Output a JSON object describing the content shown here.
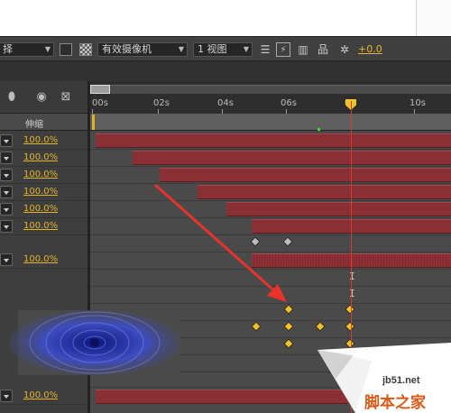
{
  "viewer_toolbar": {
    "partial_label": "择",
    "camera_dropdown": "有效摄像机",
    "view_dropdown": "1 视图",
    "exposure_value": "+0.0"
  },
  "ruler": {
    "ticks": [
      "00s",
      "02s",
      "04s",
      "06s",
      "08s",
      "10s"
    ],
    "current_time_label": "0"
  },
  "layers_header": {
    "stretch_label": "伸缩"
  },
  "layers": [
    {
      "stretch": "100.0%"
    },
    {
      "stretch": "100.0%"
    },
    {
      "stretch": "100.0%"
    },
    {
      "stretch": "100.0%"
    },
    {
      "stretch": "100.0%"
    },
    {
      "stretch": "100.0%"
    },
    {
      "stretch": "100.0%"
    },
    {
      "stretch": "100.0%"
    }
  ],
  "icons": [
    "shy-layers-icon",
    "motion-blur-icon",
    "graph-editor-icon",
    "checker-icon",
    "layout-icon",
    "fast-preview-icon",
    "3d-view-icon",
    "flowchart-icon",
    "exposure-icon"
  ],
  "colors": {
    "layer_bar": "#8a3035",
    "keyframe": "#f2c22a",
    "keyframe_inactive": "#bdbdbd",
    "playhead": "#d63c2b",
    "accent_value": "#e2b52a",
    "arrow": "#e8322b"
  },
  "watermark": {
    "site": "jb51.net",
    "text": "脚本之家"
  }
}
